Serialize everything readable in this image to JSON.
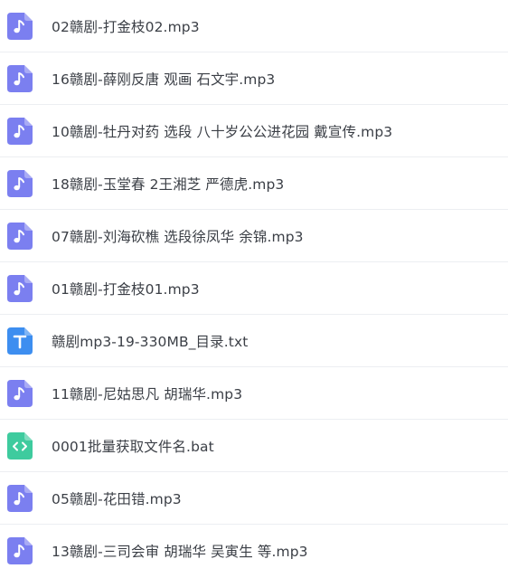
{
  "files": [
    {
      "name": "02赣剧-打金枝02.mp3",
      "icon": "music-file-icon",
      "color": "#7b7ff0"
    },
    {
      "name": "16赣剧-薛刚反唐 观画 石文宇.mp3",
      "icon": "music-file-icon",
      "color": "#7b7ff0"
    },
    {
      "name": "10赣剧-牡丹对药 选段 八十岁公公进花园 戴宣传.mp3",
      "icon": "music-file-icon",
      "color": "#7b7ff0"
    },
    {
      "name": "18赣剧-玉堂春 2王湘芝 严德虎.mp3",
      "icon": "music-file-icon",
      "color": "#7b7ff0"
    },
    {
      "name": "07赣剧-刘海砍樵 选段徐凤华 余锦.mp3",
      "icon": "music-file-icon",
      "color": "#7b7ff0"
    },
    {
      "name": "01赣剧-打金枝01.mp3",
      "icon": "music-file-icon",
      "color": "#7b7ff0"
    },
    {
      "name": "赣剧mp3-19-330MB_目录.txt",
      "icon": "text-file-icon",
      "color": "#3d8ef0"
    },
    {
      "name": "11赣剧-尼姑思凡 胡瑞华.mp3",
      "icon": "music-file-icon",
      "color": "#7b7ff0"
    },
    {
      "name": "0001批量获取文件名.bat",
      "icon": "code-file-icon",
      "color": "#3ecb9e"
    },
    {
      "name": "05赣剧-花田错.mp3",
      "icon": "music-file-icon",
      "color": "#7b7ff0"
    },
    {
      "name": "13赣剧-三司会审 胡瑞华 吴寅生 等.mp3",
      "icon": "music-file-icon",
      "color": "#7b7ff0"
    }
  ]
}
